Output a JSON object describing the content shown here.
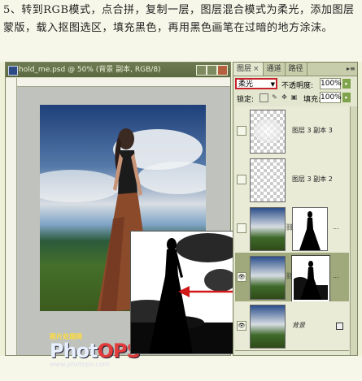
{
  "caption": {
    "text": "5、转到RGB模式，点合拼，复制一层，图层混合模式为柔光，添加图层蒙版，载入抠图选区，填充黑色，再用黑色画笔在过暗的地方涂沫。"
  },
  "document": {
    "title": "hold_me.psd @ 50% (背景 副本, RGB/8)"
  },
  "layers_panel": {
    "tabs": [
      "图层",
      "通道",
      "路径"
    ],
    "active_tab": "图层",
    "blend_mode": "柔光",
    "opacity_label": "不透明度:",
    "opacity_value": "100%",
    "lock_label": "锁定:",
    "fill_label": "填充:",
    "fill_value": "100%",
    "layers": [
      {
        "name": "图层 3 副本 3"
      },
      {
        "name": "图层 3 副本 2"
      },
      {
        "name": "",
        "dots": "..."
      },
      {
        "name": "",
        "dots": "..."
      },
      {
        "name": "背景",
        "dots": ""
      }
    ]
  },
  "watermark": {
    "cn": "照片处理网",
    "logo_a": "Phot",
    "logo_b": "OPS",
    "url": "www.photops.com"
  },
  "colors": {
    "accent_red": "#c8232c",
    "title_bar": "#5b6841"
  }
}
